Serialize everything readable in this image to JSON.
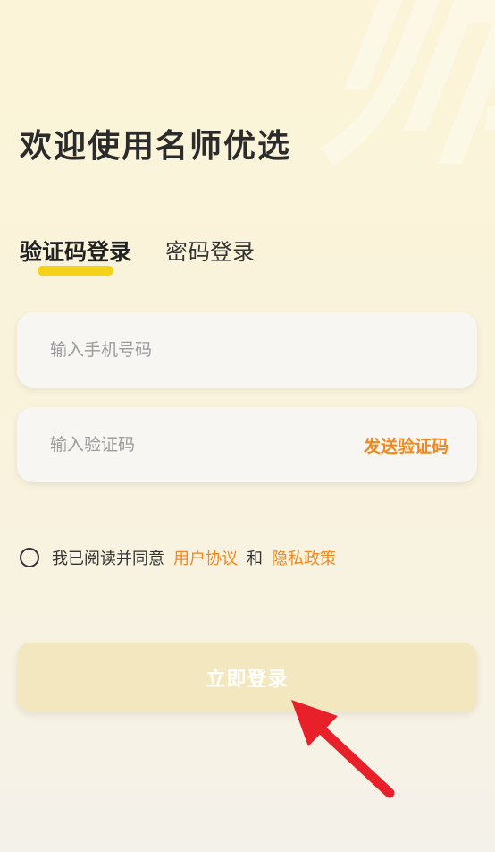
{
  "header": {
    "title": "欢迎使用名师优选"
  },
  "watermark": "师",
  "tabs": [
    {
      "label": "验证码登录",
      "active": true
    },
    {
      "label": "密码登录",
      "active": false
    }
  ],
  "phone_field": {
    "placeholder": "输入手机号码"
  },
  "code_field": {
    "placeholder": "输入验证码",
    "send_label": "发送验证码"
  },
  "agreement": {
    "prefix": "我已阅读并同意",
    "user_agreement": "用户协议",
    "and": "和",
    "privacy_policy": "隐私政策"
  },
  "login_button": {
    "label": "立即登录"
  },
  "colors": {
    "accent": "#f0891f",
    "tab_underline": "#f5d21a",
    "button_bg": "#f2e7be",
    "arrow": "#e8202a"
  }
}
